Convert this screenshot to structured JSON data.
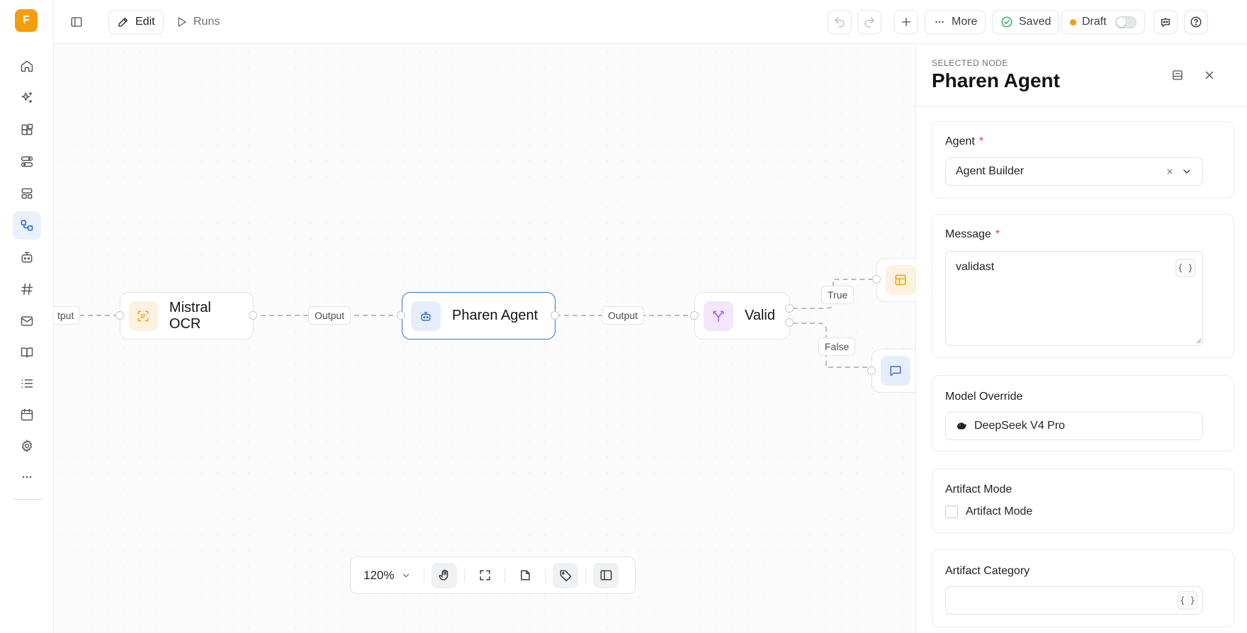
{
  "app": {
    "logo_letter": "F"
  },
  "topbar": {
    "edit_label": "Edit",
    "runs_label": "Runs",
    "more_label": "More",
    "saved_label": "Saved",
    "draft_label": "Draft"
  },
  "canvas": {
    "edge_left_partial": "tput",
    "edge_output_1": "Output",
    "edge_output_2": "Output",
    "edge_true": "True",
    "edge_false": "False",
    "nodes": {
      "ocr": "Mistral OCR",
      "agent": "Pharen Agent",
      "valid": "Valid"
    },
    "zoom": "120%"
  },
  "panel": {
    "kicker": "SELECTED NODE",
    "title": "Pharen Agent",
    "agent": {
      "label": "Agent",
      "required": "*",
      "value": "Agent Builder"
    },
    "message": {
      "label": "Message",
      "required": "*",
      "value": "validast",
      "var_label": "{ }"
    },
    "model": {
      "label": "Model Override",
      "value": "DeepSeek V4 Pro"
    },
    "artifact_mode": {
      "label": "Artifact Mode",
      "checkbox_label": "Artifact Mode"
    },
    "artifact_category": {
      "label": "Artifact Category",
      "value": "",
      "var_label": "{ }"
    }
  },
  "colors": {
    "accent": "#2463d6",
    "logo": "#f59e0b",
    "node_ocr": "#f59e0b",
    "node_agent": "#3b6fd4",
    "node_valid": "#a855f7",
    "required": "#e04646",
    "saved": "#22a55b"
  }
}
